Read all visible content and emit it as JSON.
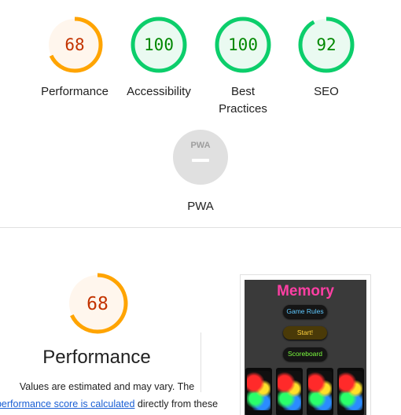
{
  "categories": [
    {
      "id": "performance",
      "score": "68",
      "label": "Performance",
      "status": "average"
    },
    {
      "id": "accessibility",
      "score": "100",
      "label": "Accessibility",
      "status": "pass"
    },
    {
      "id": "best_practices",
      "score": "100",
      "label": "Best Practices",
      "status": "pass"
    },
    {
      "id": "seo",
      "score": "92",
      "label": "SEO",
      "status": "pass"
    }
  ],
  "pwa": {
    "label": "PWA",
    "badge_text": "PWA"
  },
  "performance_section": {
    "score": "68",
    "title": "Performance",
    "desc_line1": "Values are estimated and may vary. The",
    "desc_link": "performance score is calculated",
    "desc_line2_rest": " directly from these"
  },
  "thumbnail": {
    "title": "Memory",
    "buttons": [
      "Game Rules",
      "Start!",
      "Scoreboard"
    ]
  },
  "colors": {
    "average": "#ffa400",
    "average_text": "#c33300",
    "average_fill": "#fff6ed",
    "pass": "#0cce6b",
    "pass_text": "#008800",
    "pass_fill": "#eafaf1",
    "pwa_gray": "#e0e0e0"
  }
}
